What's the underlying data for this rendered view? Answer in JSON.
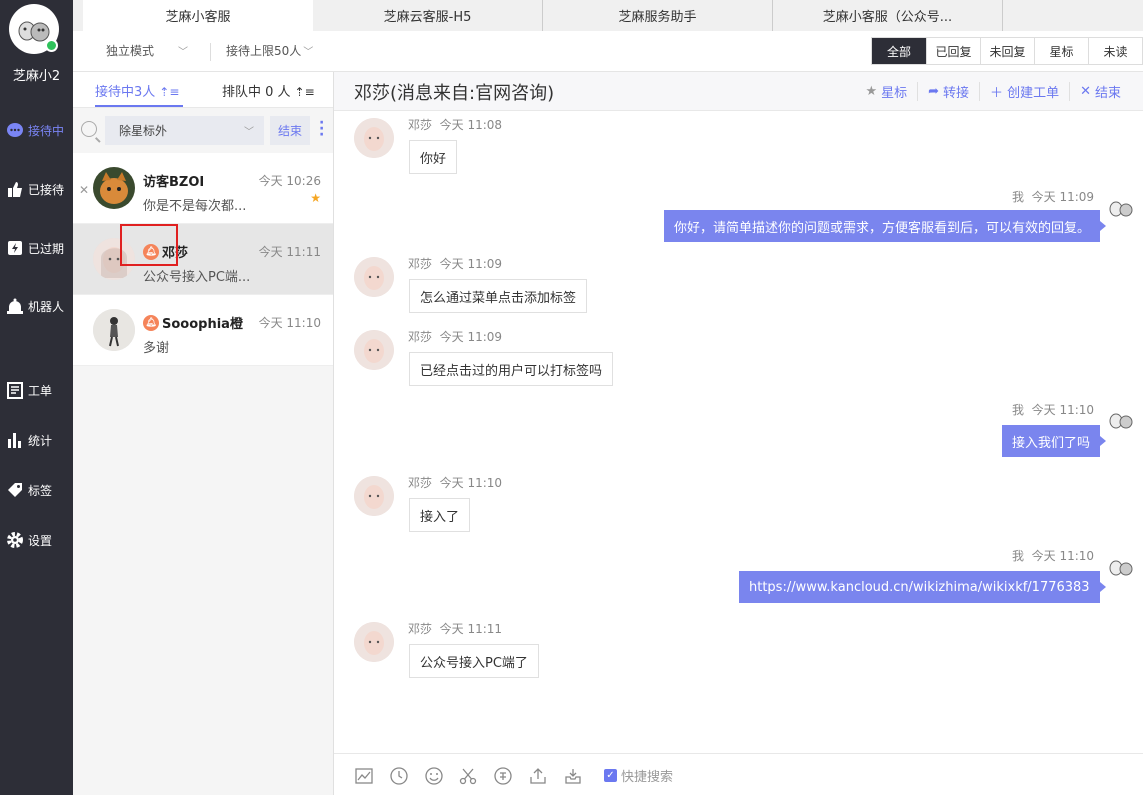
{
  "nav": {
    "username": "芝麻小2",
    "items": [
      {
        "label": "接待中",
        "icon": "chat-bubble-icon"
      },
      {
        "label": "已接待",
        "icon": "thumb-up-icon"
      },
      {
        "label": "已过期",
        "icon": "expired-icon"
      },
      {
        "label": "机器人",
        "icon": "robot-icon"
      },
      {
        "label": "工单",
        "icon": "ticket-icon"
      },
      {
        "label": "统计",
        "icon": "bar-chart-icon"
      },
      {
        "label": "标签",
        "icon": "tag-icon"
      },
      {
        "label": "设置",
        "icon": "gear-icon"
      }
    ]
  },
  "tabs": [
    "芝麻小客服",
    "芝麻云客服-H5",
    "芝麻服务助手",
    "芝麻小客服（公众号..."
  ],
  "subbar": {
    "mode": "独立模式",
    "limit": "接待上限50人",
    "filters": [
      "全部",
      "已回复",
      "未回复",
      "星标",
      "未读"
    ]
  },
  "list": {
    "tab_active": "接待中3人",
    "tab_queue": "排队中 0 人",
    "filter_select": "除星标外",
    "end_button": "结束",
    "conversations": [
      {
        "name": "访客BZOI",
        "time": "今天 10:26",
        "preview": "你是不是每次都...",
        "starred": true
      },
      {
        "name": "邓莎",
        "time": "今天 11:11",
        "preview": "公众号接入PC端...",
        "starred": false
      },
      {
        "name": "Sooophia橙",
        "time": "今天 11:10",
        "preview": "多谢",
        "starred": false
      }
    ]
  },
  "chat": {
    "title": "邓莎(消息来自:官网咨询)",
    "actions": [
      "星标",
      "转接",
      "创建工单",
      "结束"
    ],
    "messages": [
      {
        "from": "邓莎",
        "time": "今天 11:08",
        "text": "你好",
        "out": false
      },
      {
        "from": "我",
        "time": "今天 11:09",
        "text": "你好，请简单描述你的问题或需求，方便客服看到后，可以有效的回复。",
        "out": true
      },
      {
        "from": "邓莎",
        "time": "今天 11:09",
        "text": "怎么通过菜单点击添加标签",
        "out": false
      },
      {
        "from": "邓莎",
        "time": "今天 11:09",
        "text": "已经点击过的用户可以打标签吗",
        "out": false
      },
      {
        "from": "我",
        "time": "今天 11:10",
        "text": "接入我们了吗",
        "out": true
      },
      {
        "from": "邓莎",
        "time": "今天 11:10",
        "text": "接入了",
        "out": false
      },
      {
        "from": "我",
        "time": "今天 11:10",
        "text": "https://www.kancloud.cn/wikizhima/wikixkf/1776383",
        "out": true
      },
      {
        "from": "邓莎",
        "time": "今天 11:11",
        "text": "公众号接入PC端了",
        "out": false
      }
    ],
    "quick_search": "快捷搜索"
  },
  "colors": {
    "accent": "#6b78f0",
    "nav_bg": "#2d2e37",
    "bubble_out": "#7a85ee",
    "highlight": "#e02020"
  }
}
